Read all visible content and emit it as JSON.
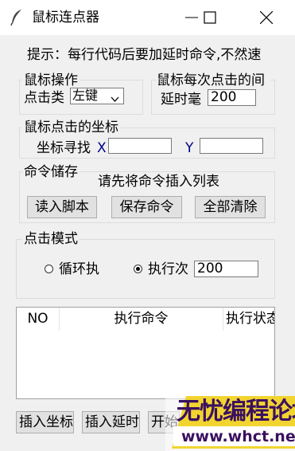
{
  "window": {
    "title": "鼠标连点器",
    "controls": {
      "minimize_icon": "minimize-icon",
      "maximize_icon": "maximize-icon",
      "close_icon": "close-icon"
    }
  },
  "hint": {
    "text": "提示：每行代码后要加延时命令,不然速"
  },
  "mouse_op": {
    "title": "鼠标操作",
    "click_type_label": "点击类",
    "click_type_value": "左键"
  },
  "interval": {
    "title": "鼠标每次点击的间",
    "delay_label": "延时毫",
    "delay_value": "200"
  },
  "coords": {
    "title": "鼠标点击的坐标",
    "find_label": "坐标寻找",
    "x_label": "X",
    "x_value": "",
    "y_label": "Y",
    "y_value": ""
  },
  "store": {
    "title": "命令储存",
    "hint": "请先将命令插入列表",
    "buttons": {
      "load": "读入脚本",
      "save": "保存命令",
      "clear": "全部清除"
    }
  },
  "click_mode": {
    "title": "点击模式",
    "loop_label": "循环执",
    "times_label": "执行次",
    "selected": "times",
    "times_value": "200"
  },
  "table": {
    "columns": [
      "NO",
      "执行命令",
      "执行状态"
    ],
    "rows": []
  },
  "bottom_buttons": {
    "insert_coord": "插入坐标",
    "insert_delay": "插入延时",
    "start": "开始"
  },
  "watermark": {
    "line1": "无忧编程论坛",
    "line2": "www.whct.net"
  },
  "colors": {
    "window_bg": "#f0f0f0",
    "titlebar_bg": "#ffffff",
    "xy_label": "#00008b",
    "watermark": "#3a1060"
  }
}
